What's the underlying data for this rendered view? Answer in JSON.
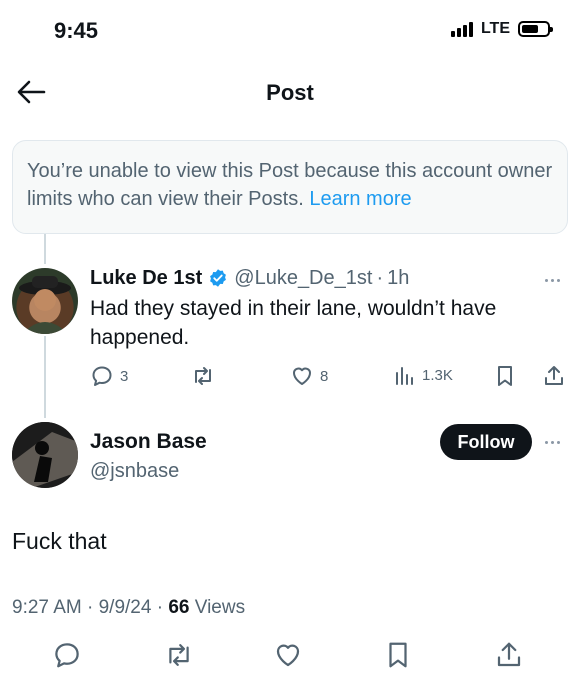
{
  "status_bar": {
    "time": "9:45",
    "network": "LTE"
  },
  "nav": {
    "title": "Post"
  },
  "notice": {
    "text": "You’re unable to view this Post because this account owner limits who can view their Posts.",
    "link": "Learn more"
  },
  "reply": {
    "name": "Luke De 1st",
    "handle": "@Luke_De_1st",
    "separator": "·",
    "time": "1h",
    "text": "Had they stayed in their lane, wouldn’t have happened.",
    "replies": "3",
    "likes": "8",
    "views": "1.3K"
  },
  "post": {
    "name": "Jason Base",
    "handle": "@jsnbase",
    "follow_label": "Follow",
    "text": "Fuck that",
    "time": "9:27 AM",
    "date": "9/9/24",
    "views_count": "66",
    "views_label": "Views"
  },
  "colors": {
    "accent": "#1d9bf0",
    "text": "#0f1419",
    "muted": "#536471"
  }
}
